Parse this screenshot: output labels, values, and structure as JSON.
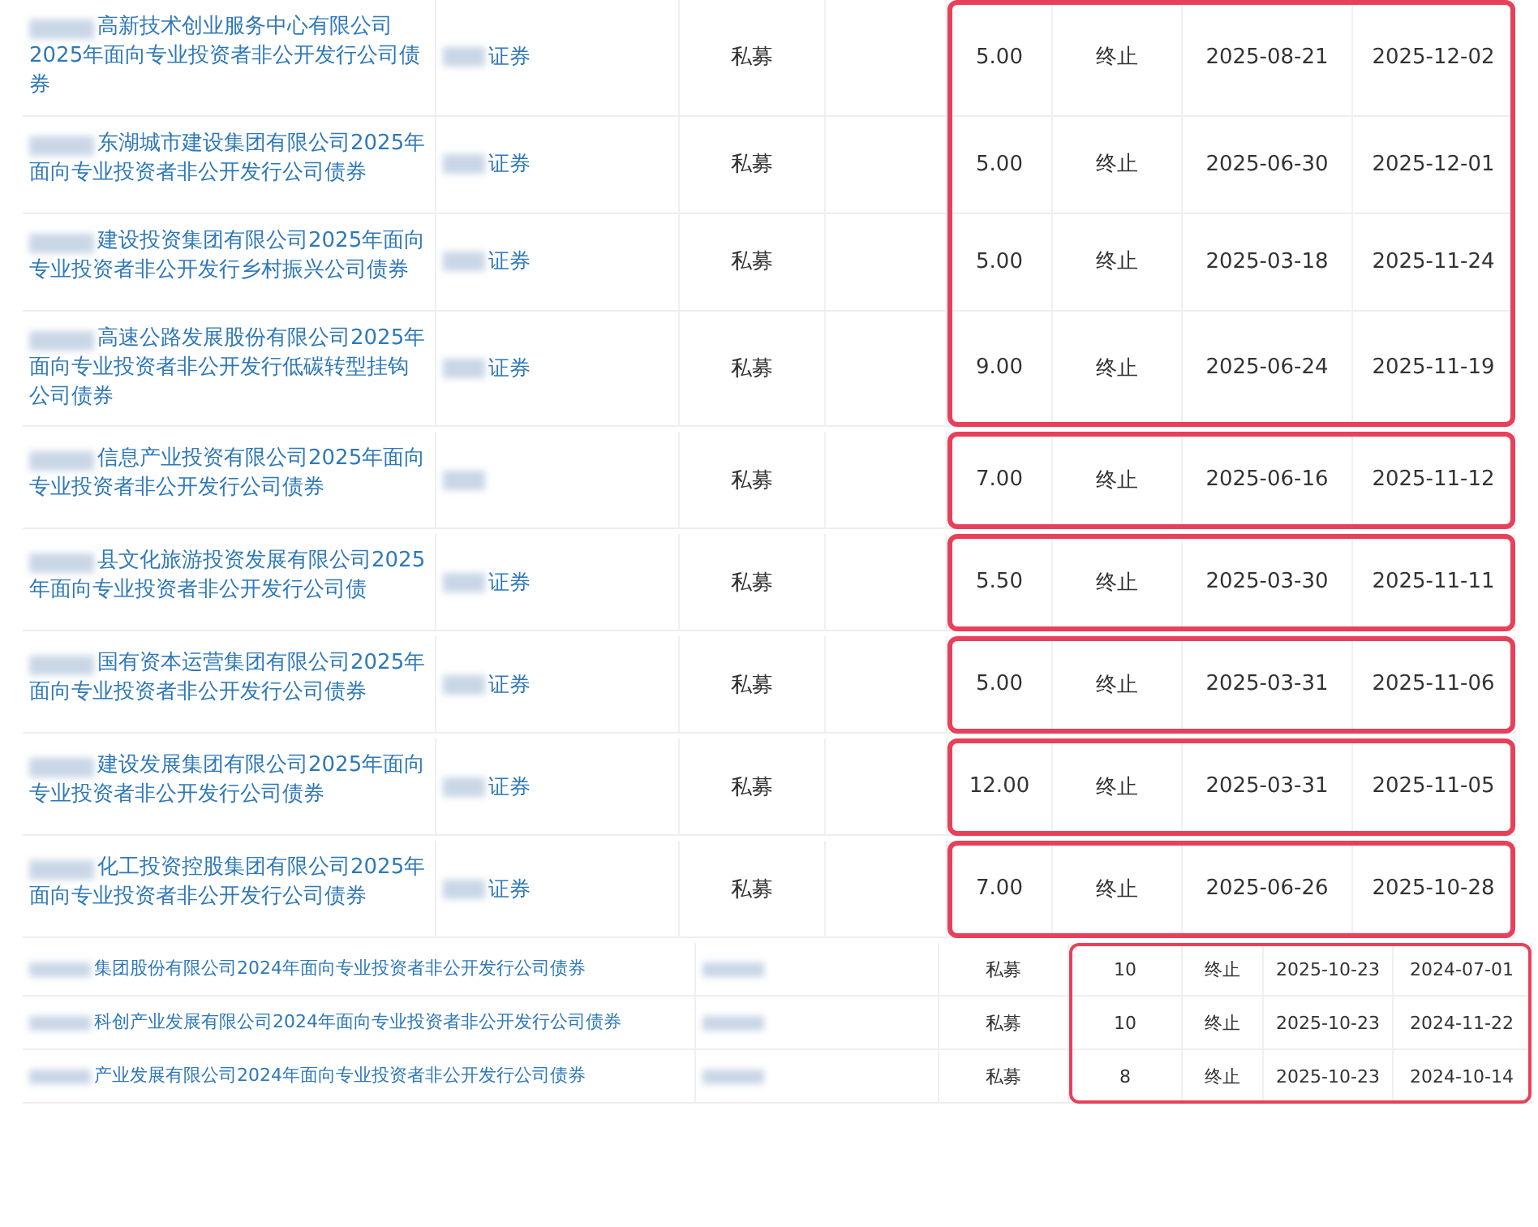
{
  "sections": [
    {
      "kind": "wide",
      "highlighted": true,
      "rows": [
        {
          "name": "高新技术创业服务中心有限公司2025年面向专业投资者非公开发行公司债券",
          "underwriter": "证券",
          "type": "私募",
          "amount": "5.00",
          "status": "终止",
          "date_1": "2025-08-21",
          "date_2": "2025-12-02"
        },
        {
          "name": "东湖城市建设集团有限公司2025年面向专业投资者非公开发行公司债券",
          "underwriter": "证券",
          "type": "私募",
          "amount": "5.00",
          "status": "终止",
          "date_1": "2025-06-30",
          "date_2": "2025-12-01"
        },
        {
          "name": "建设投资集团有限公司2025年面向专业投资者非公开发行乡村振兴公司债券",
          "underwriter": "证券",
          "type": "私募",
          "amount": "5.00",
          "status": "终止",
          "date_1": "2025-03-18",
          "date_2": "2025-11-24"
        },
        {
          "name": "高速公路发展股份有限公司2025年面向专业投资者非公开发行低碳转型挂钩公司债券",
          "underwriter": "证券",
          "type": "私募",
          "amount": "9.00",
          "status": "终止",
          "date_1": "2025-06-24",
          "date_2": "2025-11-19"
        }
      ]
    },
    {
      "kind": "wide",
      "highlighted": true,
      "rows": [
        {
          "name": "信息产业投资有限公司2025年面向专业投资者非公开发行公司债券",
          "type": "私募",
          "amount": "7.00",
          "status": "终止",
          "date_1": "2025-06-16",
          "date_2": "2025-11-12"
        }
      ]
    },
    {
      "kind": "wide",
      "highlighted": true,
      "rows": [
        {
          "name": "县文化旅游投资发展有限公司2025年面向专业投资者非公开发行公司债",
          "underwriter": "证券",
          "type": "私募",
          "amount": "5.50",
          "status": "终止",
          "date_1": "2025-03-30",
          "date_2": "2025-11-11"
        }
      ]
    },
    {
      "kind": "wide",
      "highlighted": true,
      "rows": [
        {
          "name": "国有资本运营集团有限公司2025年面向专业投资者非公开发行公司债券",
          "underwriter": "证券",
          "type": "私募",
          "amount": "5.00",
          "status": "终止",
          "date_1": "2025-03-31",
          "date_2": "2025-11-06"
        }
      ]
    },
    {
      "kind": "wide",
      "highlighted": true,
      "rows": [
        {
          "name": "建设发展集团有限公司2025年面向专业投资者非公开发行公司债券",
          "underwriter": "证券",
          "type": "私募",
          "amount": "12.00",
          "status": "终止",
          "date_1": "2025-03-31",
          "date_2": "2025-11-05"
        }
      ]
    },
    {
      "kind": "wide",
      "highlighted": true,
      "rows": [
        {
          "name": "化工投资控股集团有限公司2025年面向专业投资者非公开发行公司债券",
          "underwriter": "证券",
          "type": "私募",
          "amount": "7.00",
          "status": "终止",
          "date_1": "2025-06-26",
          "date_2": "2025-10-28"
        }
      ]
    },
    {
      "kind": "compact",
      "highlighted": true,
      "rows": [
        {
          "name": "集团股份有限公司2024年面向专业投资者非公开发行公司债券",
          "type": "私募",
          "amount": "10",
          "status": "终止",
          "date_1": "2025-10-23",
          "date_2": "2024-07-01"
        },
        {
          "name": "科创产业发展有限公司2024年面向专业投资者非公开发行公司债券",
          "type": "私募",
          "amount": "10",
          "status": "终止",
          "date_1": "2025-10-23",
          "date_2": "2024-11-22"
        },
        {
          "name": "产业发展有限公司2024年面向专业投资者非公开发行公司债券",
          "type": "私募",
          "amount": "8",
          "status": "终止",
          "date_1": "2025-10-23",
          "date_2": "2024-10-14"
        }
      ]
    }
  ]
}
